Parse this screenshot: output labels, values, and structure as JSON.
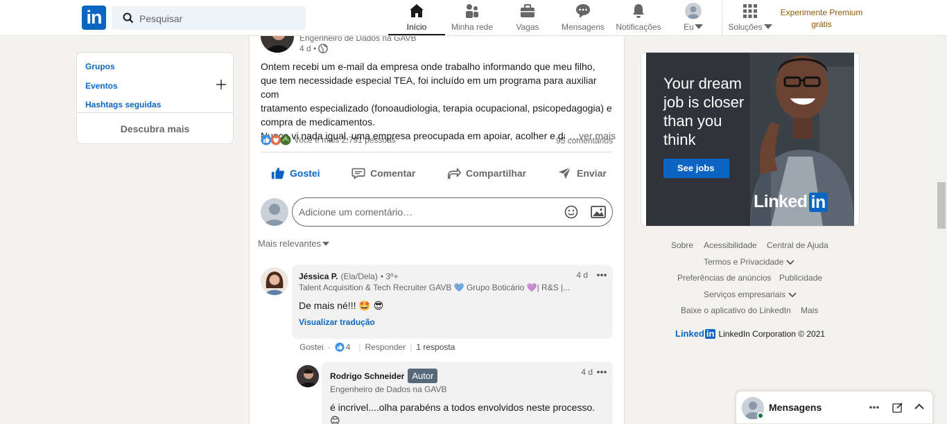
{
  "nav": {
    "search_placeholder": "Pesquisar",
    "items": [
      {
        "label": "Início",
        "icon": "home-icon"
      },
      {
        "label": "Minha rede",
        "icon": "network-icon"
      },
      {
        "label": "Vagas",
        "icon": "briefcase-icon"
      },
      {
        "label": "Mensagens",
        "icon": "messaging-icon"
      },
      {
        "label": "Notificações",
        "icon": "bell-icon"
      },
      {
        "label": "Eu",
        "icon": "avatar"
      },
      {
        "label": "Soluções",
        "icon": "grid-icon"
      }
    ],
    "premium_line1": "Experimente Premium",
    "premium_line2": "grátis"
  },
  "left": {
    "groups": "Grupos",
    "events": "Eventos",
    "hashtags": "Hashtags seguidas",
    "discover": "Descubra mais"
  },
  "post": {
    "author_headline": "Engenheiro de Dados na GAVB",
    "time": "4 d •",
    "body_lines": [
      "Ontem recebi um e-mail da empresa onde trabalho informando que meu filho,",
      "que tem necessidade especial TEA, foi incluído em um programa para auxiliar com",
      "tratamento especializado (fonoaudiologia, terapia ocupacional, psicopedagogia) e",
      "compra de medicamentos.",
      "Nunca vi nada igual, uma empresa preocupada em apoiar, acolher e da"
    ],
    "see_more": "…ver mais",
    "reactions_text": "Você e mais 2.791 pessoas",
    "comments_count": "95 comentários",
    "actions": {
      "like": "Gostei",
      "comment": "Comentar",
      "share": "Compartilhar",
      "send": "Enviar"
    },
    "comment_placeholder": "Adicione um comentário…",
    "sort_label": "Mais relevantes"
  },
  "comments": [
    {
      "name": "Jéssica P.",
      "pronouns": "(Ela/Dela)",
      "degree": "• 3º+",
      "headline": "Talent Acquisition & Tech Recruiter GAVB 💙 Grupo Boticário 💜| R&S |...",
      "time": "4 d",
      "text": "De mais né!!! 🤩 😎",
      "translate": "Visualizar tradução",
      "like": "Gostei",
      "dot": "·",
      "likes": "4",
      "reply": "Responder",
      "replies": "1 resposta"
    },
    {
      "name": "Rodrigo Schneider",
      "badge": "Autor",
      "headline": "Engenheiro de Dados na GAVB",
      "time": "4 d",
      "text": "é incrivel....olha parabéns a todos envolvidos neste processo.",
      "emoji": "😊"
    }
  ],
  "ad": {
    "line1": "Your dream",
    "line2": "job is closer",
    "line3": "than you",
    "line4": "think",
    "button": "See jobs",
    "brand": "Linked",
    "brand_in": "in"
  },
  "footer": {
    "about": "Sobre",
    "accessibility": "Acessibilidade",
    "help": "Central de Ajuda",
    "terms": "Termos e Privacidade",
    "ad_prefs": "Preferências de anúncios",
    "advertising": "Publicidade",
    "business": "Serviços empresariais",
    "app": "Baixe o aplicativo do LinkedIn",
    "more": "Mais",
    "brand": "Linked",
    "brand_in": "in",
    "copyright": "LinkedIn Corporation © 2021"
  },
  "messaging": {
    "label": "Mensagens"
  },
  "colors": {
    "brand": "#0a66c2",
    "premium": "#915907",
    "badge": "#56687a"
  }
}
